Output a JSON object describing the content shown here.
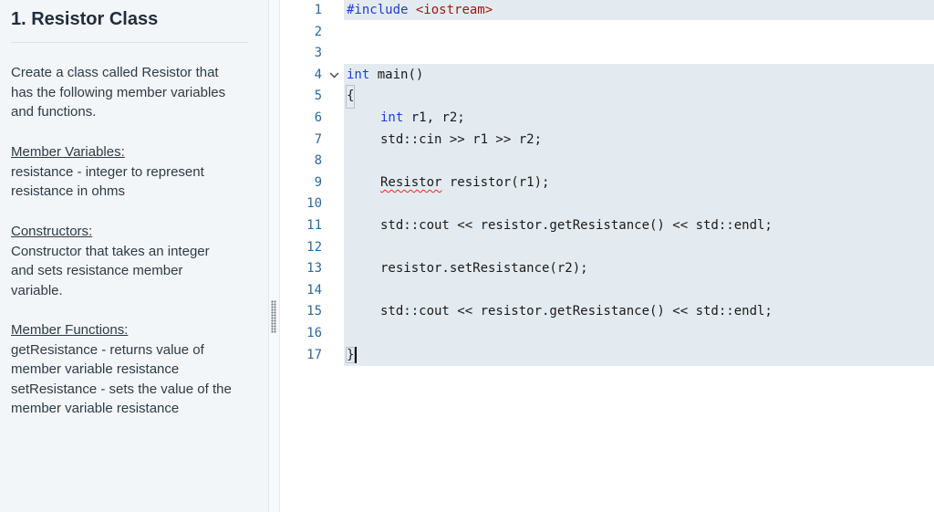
{
  "instructions": {
    "title": "1. Resistor Class",
    "intro_lines": [
      "Create a class called Resistor that",
      "has the following member variables",
      "and functions."
    ],
    "member_variables": {
      "heading": "Member Variables:",
      "lines": [
        "resistance - integer to represent",
        "resistance in ohms"
      ]
    },
    "constructors": {
      "heading": "Constructors:",
      "lines": [
        "Constructor that takes an integer",
        "and sets resistance member",
        "variable."
      ]
    },
    "member_functions": {
      "heading": "Member Functions:",
      "lines": [
        "getResistance - returns value of",
        "member variable resistance",
        "setResistance - sets the value of the",
        "member variable resistance"
      ]
    }
  },
  "editor": {
    "line_numbers": [
      "1",
      "2",
      "3",
      "4",
      "5",
      "6",
      "7",
      "8",
      "9",
      "10",
      "11",
      "12",
      "13",
      "14",
      "15",
      "16",
      "17"
    ],
    "fold_icon": "chevron-down-icon",
    "code": {
      "l1_directive": "#include",
      "l1_header": "<iostream>",
      "l4_type": "int",
      "l4_rest": " main()",
      "l5": "{",
      "l6_type": "int",
      "l6_rest": " r1, r2;",
      "l7": "std::cin >> r1 >> r2;",
      "l9_class": "Resistor",
      "l9_rest": " resistor(r1);",
      "l11": "std::cout << resistor.getResistance() << std::endl;",
      "l13": "resistor.setResistance(r2);",
      "l15": "std::cout << resistor.getResistance() << std::endl;",
      "l17": "}"
    }
  }
}
